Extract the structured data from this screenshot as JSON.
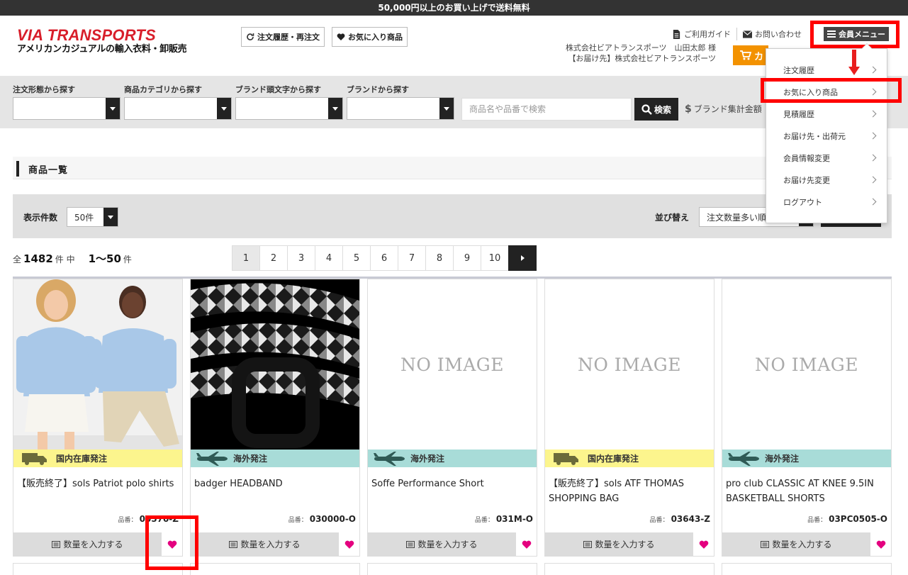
{
  "topbar": {
    "text": "50,000円以上のお買い上げで送料無料"
  },
  "logo": {
    "main": "VIA TRANSPORTS",
    "sub": "アメリカンカジュアルの輸入衣料・卸販売"
  },
  "header": {
    "order_history_reorder": "注文履歴・再注文",
    "favorites": "お気に入り商品",
    "guide": "ご利用ガイド",
    "contact": "お問い合わせ",
    "member_menu": "会員メニュー",
    "user_line1": "株式会社ビアトランスポーツ　山田太郎 様",
    "user_line2": "【お届け先】株式会社ビアトランスポーツ",
    "cart": "カ"
  },
  "search": {
    "label_order_type": "注文形態から探す",
    "label_category": "商品カテゴリから探す",
    "label_brand_initial": "ブランド頭文字から探す",
    "label_brand": "ブランドから探す",
    "keyword_placeholder": "商品名や品番で検索",
    "search_button": "検索",
    "brand_total": "ブランド集計金額"
  },
  "member_dropdown": {
    "items": [
      {
        "label": "注文履歴"
      },
      {
        "label": "お気に入り商品"
      },
      {
        "label": "見積履歴"
      },
      {
        "label": "お届け先・出荷元"
      },
      {
        "label": "会員情報変更"
      },
      {
        "label": "お届け先変更"
      },
      {
        "label": "ログアウト"
      }
    ]
  },
  "listing": {
    "title": "商品一覧",
    "per_page_label": "表示件数",
    "per_page_value": "50件",
    "sort_label": "並び替え",
    "sort_value": "注文数量多い順",
    "count_prefix": "全",
    "count_total": "1482",
    "count_mid": "件 中",
    "count_range": "1〜50",
    "count_suffix": "件",
    "pages": [
      "1",
      "2",
      "3",
      "4",
      "5",
      "6",
      "7",
      "8",
      "9",
      "10"
    ]
  },
  "products": [
    {
      "ship": "国内在庫発注",
      "ship_type": "domestic",
      "name": "【販売終了】sols Patriot polo shirts",
      "code_label": "品番：",
      "code": "00570-Z",
      "qty_button": "数量を入力する",
      "image": "photo-kids"
    },
    {
      "ship": "海外発注",
      "ship_type": "overseas",
      "name": "badger HEADBAND",
      "code_label": "品番：",
      "code": "030000-O",
      "qty_button": "数量を入力する",
      "image": "photo-belt"
    },
    {
      "ship": "海外発注",
      "ship_type": "overseas",
      "name": "Soffe Performance Short",
      "code_label": "品番：",
      "code": "031M-O",
      "qty_button": "数量を入力する",
      "image": "NO IMAGE"
    },
    {
      "ship": "国内在庫発注",
      "ship_type": "domestic",
      "name": "【販売終了】sols ATF THOMAS SHOPPING BAG",
      "code_label": "品番：",
      "code": "03643-Z",
      "qty_button": "数量を入力する",
      "image": "NO IMAGE"
    },
    {
      "ship": "海外発注",
      "ship_type": "overseas",
      "name": "pro club CLASSIC AT KNEE 9.5IN BASKETBALL SHORTS",
      "code_label": "品番：",
      "code": "03PC0505-O",
      "qty_button": "数量を入力する",
      "image": "NO IMAGE"
    }
  ],
  "colors": {
    "brand_red": "#d81e2a",
    "cart_orange": "#f39200",
    "heart_pink": "#e4007f",
    "domestic_yellow": "#fcf58d",
    "overseas_teal": "#a8dcd8",
    "highlight_red": "#ff0000"
  },
  "icons": [
    "refresh-icon",
    "heart-icon",
    "document-icon",
    "envelope-icon",
    "hamburger-icon",
    "cart-icon",
    "search-icon",
    "dollar-icon",
    "truck-icon",
    "airplane-icon",
    "list-icon",
    "chevron-right-icon"
  ]
}
